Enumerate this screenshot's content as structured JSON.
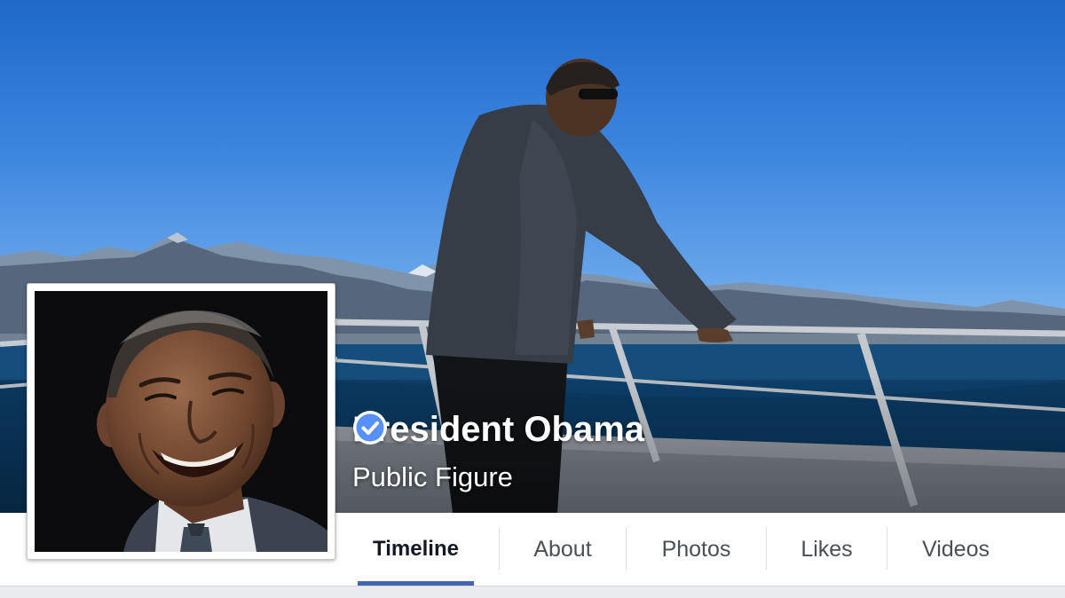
{
  "profile": {
    "name": "President Obama",
    "category": "Public Figure",
    "verified": true,
    "cover_photo_icon": "cover-photo",
    "profile_photo_icon": "profile-photo"
  },
  "nav": {
    "tabs": [
      {
        "label": "Timeline",
        "active": true
      },
      {
        "label": "About",
        "active": false
      },
      {
        "label": "Photos",
        "active": false
      },
      {
        "label": "Likes",
        "active": false
      },
      {
        "label": "Videos",
        "active": false
      }
    ]
  },
  "colors": {
    "accent": "#4267b2",
    "verified_badge": "#5890ff",
    "nav_text": "#4b4f56",
    "page_bg": "#e9ebee"
  }
}
